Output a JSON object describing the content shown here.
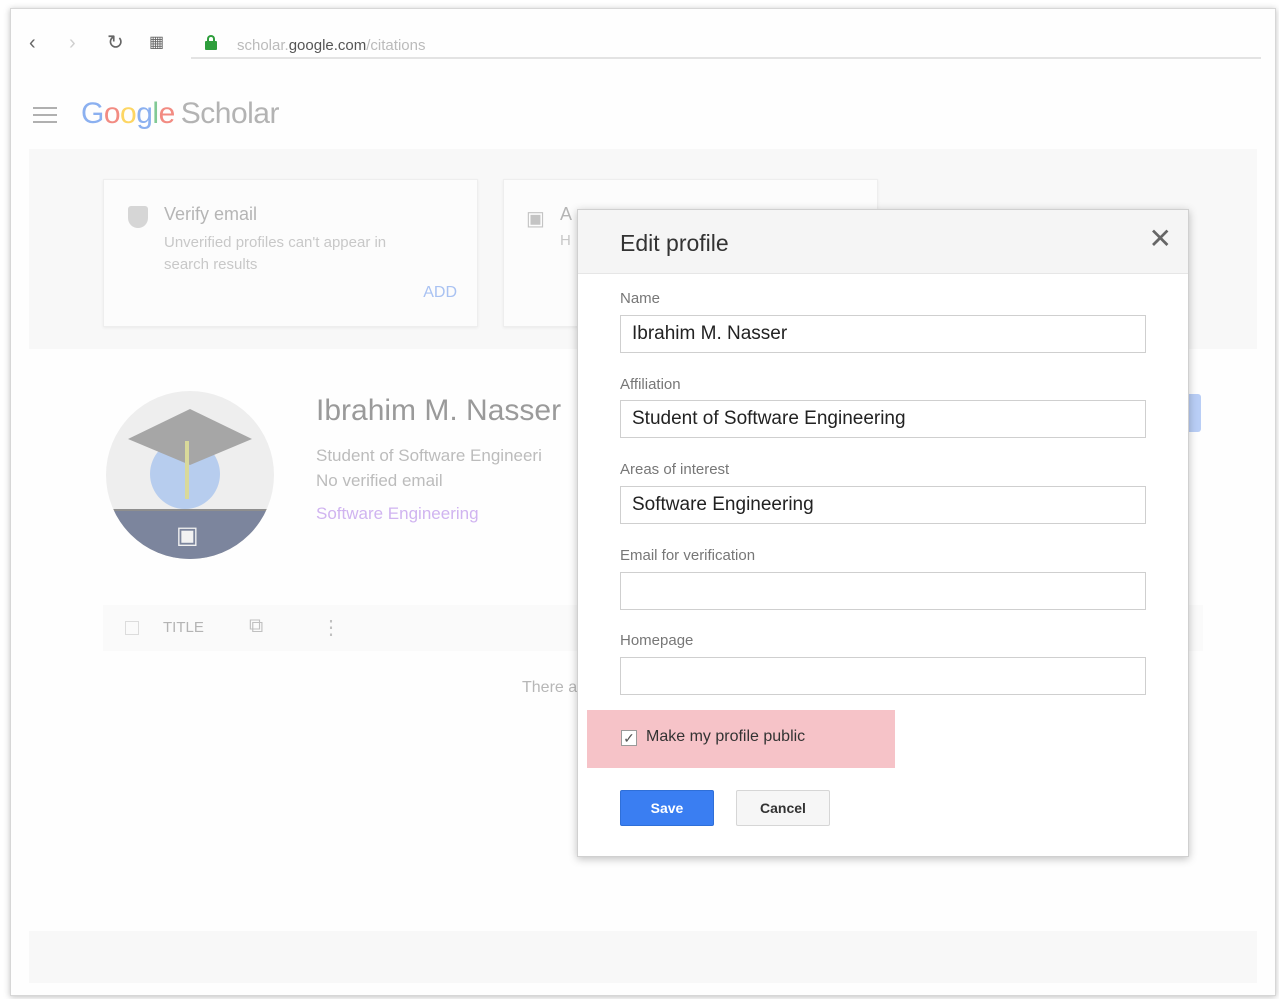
{
  "browser": {
    "url_prefix": "scholar.",
    "url_domain": "google.com",
    "url_path": "/citations"
  },
  "header": {
    "logo_letters": [
      "G",
      "o",
      "o",
      "g",
      "l",
      "e"
    ],
    "logo_suffix": "Scholar"
  },
  "cards": [
    {
      "title": "Verify email",
      "description": "Unverified profiles can't appear in search results",
      "action": "ADD"
    },
    {
      "title": "A",
      "description": "H"
    }
  ],
  "profile": {
    "name": "Ibrahim M. Nasser",
    "affiliation": "Student of Software Engineeri",
    "email_status": "No verified email",
    "interest": "Software Engineering"
  },
  "table": {
    "title_col": "TITLE",
    "empty_message": "There a"
  },
  "dialog": {
    "title": "Edit profile",
    "fields": [
      {
        "label": "Name",
        "value": "Ibrahim M. Nasser"
      },
      {
        "label": "Affiliation",
        "value": "Student of Software Engineering"
      },
      {
        "label": "Areas of interest",
        "value": "Software Engineering"
      },
      {
        "label": "Email for verification",
        "value": ""
      },
      {
        "label": "Homepage",
        "value": ""
      }
    ],
    "public_checkbox": {
      "label": "Make my profile public",
      "checked": true
    },
    "save_label": "Save",
    "cancel_label": "Cancel"
  },
  "colors": {
    "accent": "#3a7ef2",
    "highlight": "#f6c3c8",
    "lock": "#2e9e3c"
  }
}
